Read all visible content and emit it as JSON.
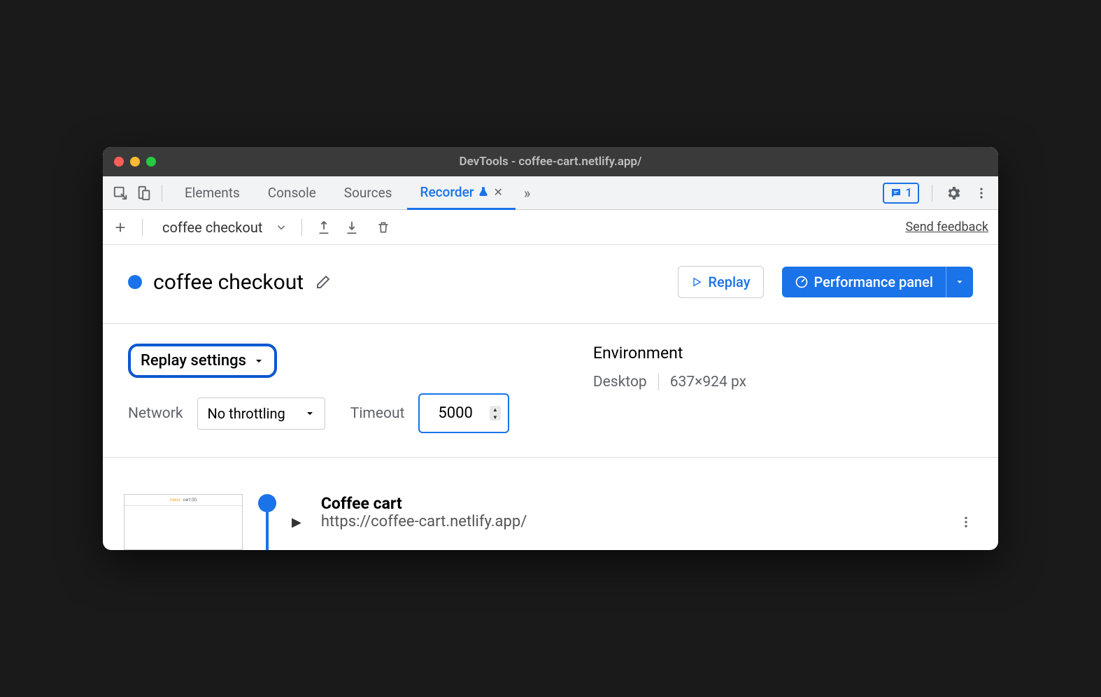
{
  "window": {
    "title": "DevTools - coffee-cart.netlify.app/"
  },
  "tabs": {
    "items": [
      "Elements",
      "Console",
      "Sources",
      "Recorder"
    ],
    "active_index": 3,
    "issues_count": "1"
  },
  "toolbar": {
    "recording_name": "coffee checkout",
    "feedback": "Send feedback"
  },
  "header": {
    "title": "coffee checkout",
    "replay_label": "Replay",
    "performance_label": "Performance panel"
  },
  "settings": {
    "replay_settings_label": "Replay settings",
    "network_label": "Network",
    "network_value": "No throttling",
    "timeout_label": "Timeout",
    "timeout_value": "5000",
    "environment_label": "Environment",
    "env_device": "Desktop",
    "env_dimensions": "637×924 px"
  },
  "step": {
    "title": "Coffee cart",
    "url": "https://coffee-cart.netlify.app/"
  }
}
